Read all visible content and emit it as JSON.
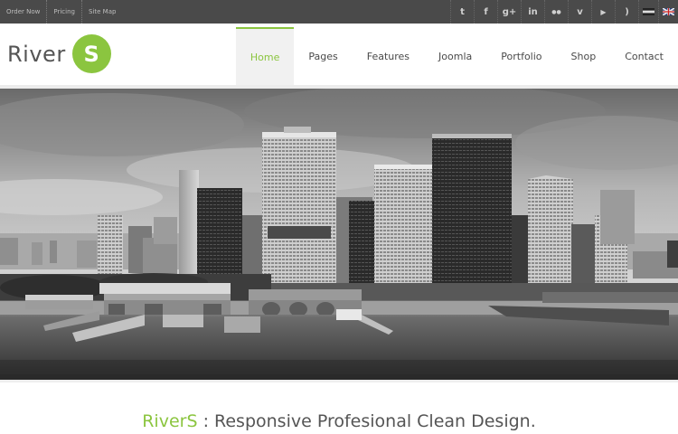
{
  "topbar": {
    "links": [
      "Order Now",
      "Pricing",
      "Site Map"
    ],
    "social_icons": [
      "twitter-icon",
      "facebook-icon",
      "googleplus-icon",
      "linkedin-icon",
      "flickr-icon",
      "vimeo-icon",
      "youtube-icon",
      "rss-icon"
    ],
    "social_glyphs": [
      "t",
      "f",
      "g+",
      "in",
      "●●",
      "v",
      "▶",
      ")"
    ],
    "languages": [
      "lang-flag-icon",
      "english-flag-icon"
    ]
  },
  "logo": {
    "text": "River",
    "badge": "S",
    "color": "#8bc53f"
  },
  "nav": {
    "items": [
      "Home",
      "Pages",
      "Features",
      "Joomla",
      "Portfolio",
      "Shop",
      "Contact"
    ],
    "active": "Home"
  },
  "hero": {
    "image": "black-and-white city skyline over water"
  },
  "tagline": {
    "brand": "RiverS",
    "separator": " : ",
    "text": "Responsive Profesional Clean Design."
  },
  "colors": {
    "accent": "#8bc53f",
    "topbar": "#4a4a4a"
  }
}
